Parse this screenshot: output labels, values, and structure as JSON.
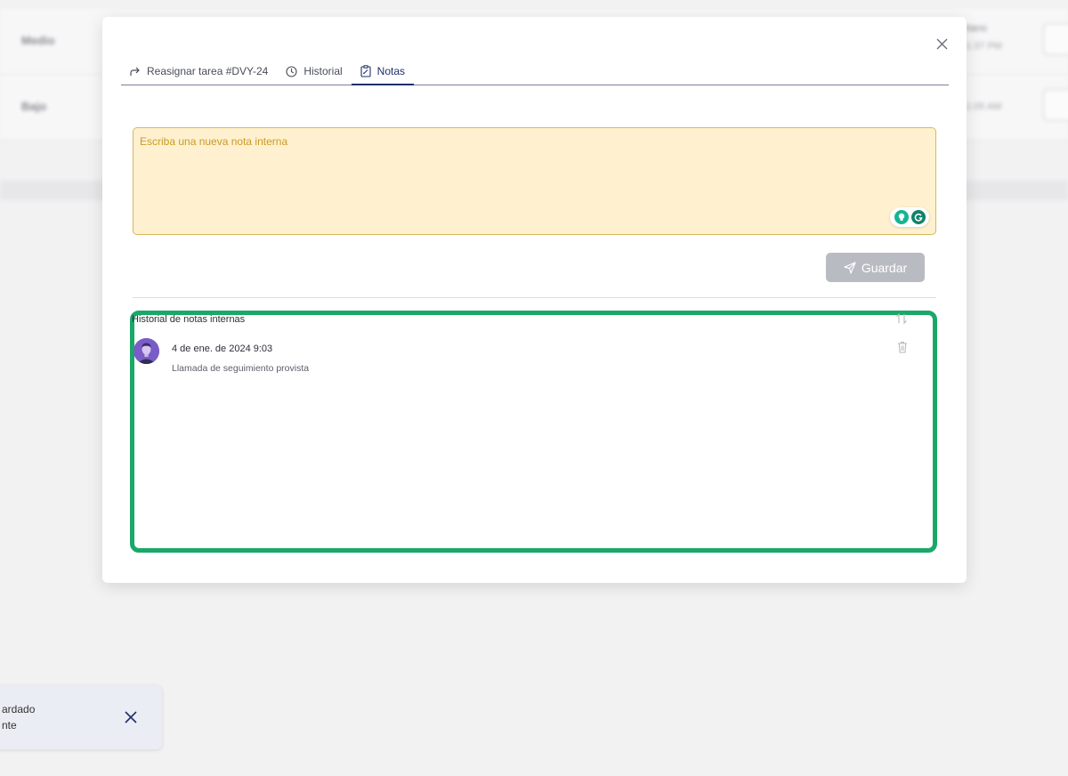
{
  "background": {
    "rows": [
      {
        "label": "Medio",
        "right_top": "itano",
        "right_bottom": "1:37 PM"
      },
      {
        "label": "Bajo",
        "right_top": "",
        "right_bottom": "1:05 AM"
      }
    ]
  },
  "modal": {
    "tabs": [
      {
        "label": "Reasignar tarea #DVY-24",
        "icon": "reassign-arrow-icon"
      },
      {
        "label": "Historial",
        "icon": "clock-icon"
      },
      {
        "label": "Notas",
        "icon": "notes-icon",
        "active": true
      }
    ],
    "note_input": {
      "placeholder": "Escriba una nueva nota interna",
      "value": ""
    },
    "save_label": "Guardar",
    "history": {
      "title": "Historial de notas internas",
      "notes": [
        {
          "date": "4 de ene. de 2024 9:03",
          "text": "Llamada de seguimiento provista"
        }
      ]
    }
  },
  "toast": {
    "line1": "ardado",
    "line2": "nte"
  },
  "colors": {
    "accent": "#1f2f6b",
    "highlight_border": "#1aa868",
    "note_bg": "#fff1cf",
    "save_disabled": "#b9bbc2"
  }
}
